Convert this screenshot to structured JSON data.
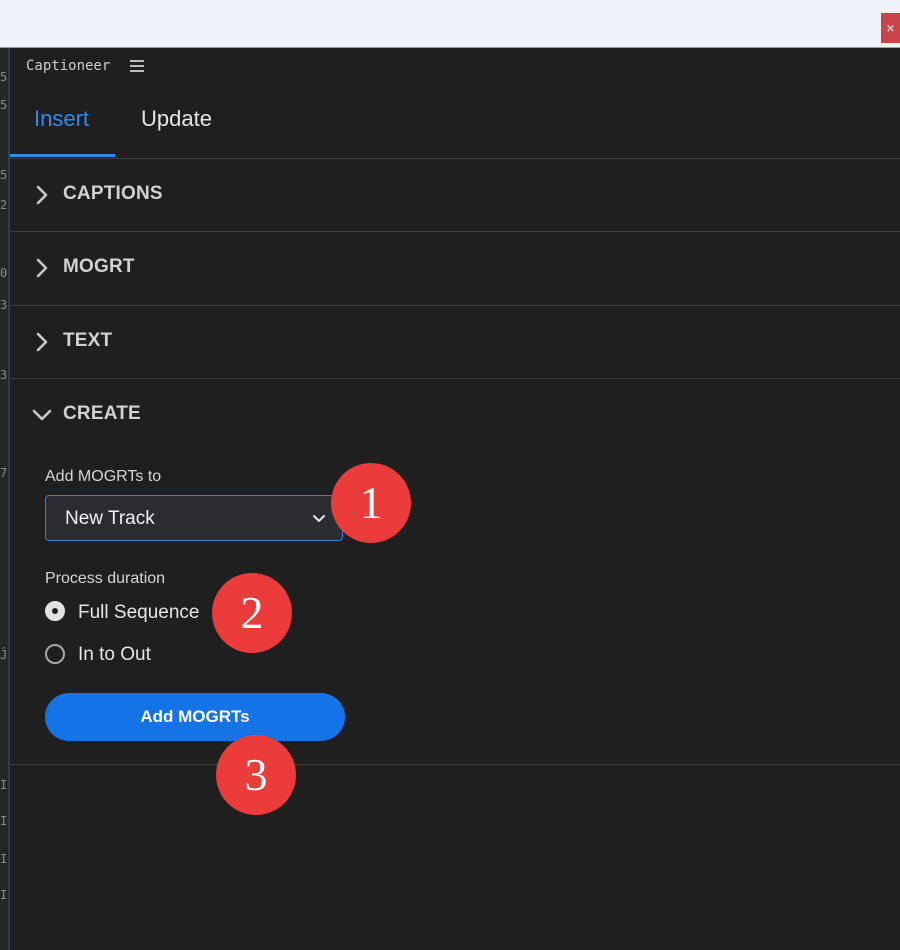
{
  "window": {
    "close_glyph": "×"
  },
  "left_strip_glyphs": [
    "5",
    "5",
    "5",
    "2",
    "0",
    "3",
    "3",
    "7",
    "Ĵ",
    "I",
    "I",
    "I",
    "I"
  ],
  "panel": {
    "title": "Captioneer",
    "menu_icon": "hamburger-icon"
  },
  "tabs": [
    {
      "label": "Insert",
      "active": true
    },
    {
      "label": "Update",
      "active": false
    }
  ],
  "accordion": [
    {
      "title": "CAPTIONS",
      "expanded": false
    },
    {
      "title": "MOGRT",
      "expanded": false
    },
    {
      "title": "TEXT",
      "expanded": false
    },
    {
      "title": "CREATE",
      "expanded": true
    }
  ],
  "create": {
    "add_to_label": "Add MOGRTs to",
    "add_to_value": "New Track",
    "process_duration_label": "Process duration",
    "options": [
      {
        "label": "Full Sequence",
        "selected": true
      },
      {
        "label": "In to Out",
        "selected": false
      }
    ],
    "submit_label": "Add MOGRTs"
  },
  "callouts": [
    "1",
    "2",
    "3"
  ],
  "colors": {
    "accent": "#2f8bf0",
    "button": "#1473e6",
    "callout": "#ec3b3b",
    "panel_bg": "#1f1f1f"
  }
}
